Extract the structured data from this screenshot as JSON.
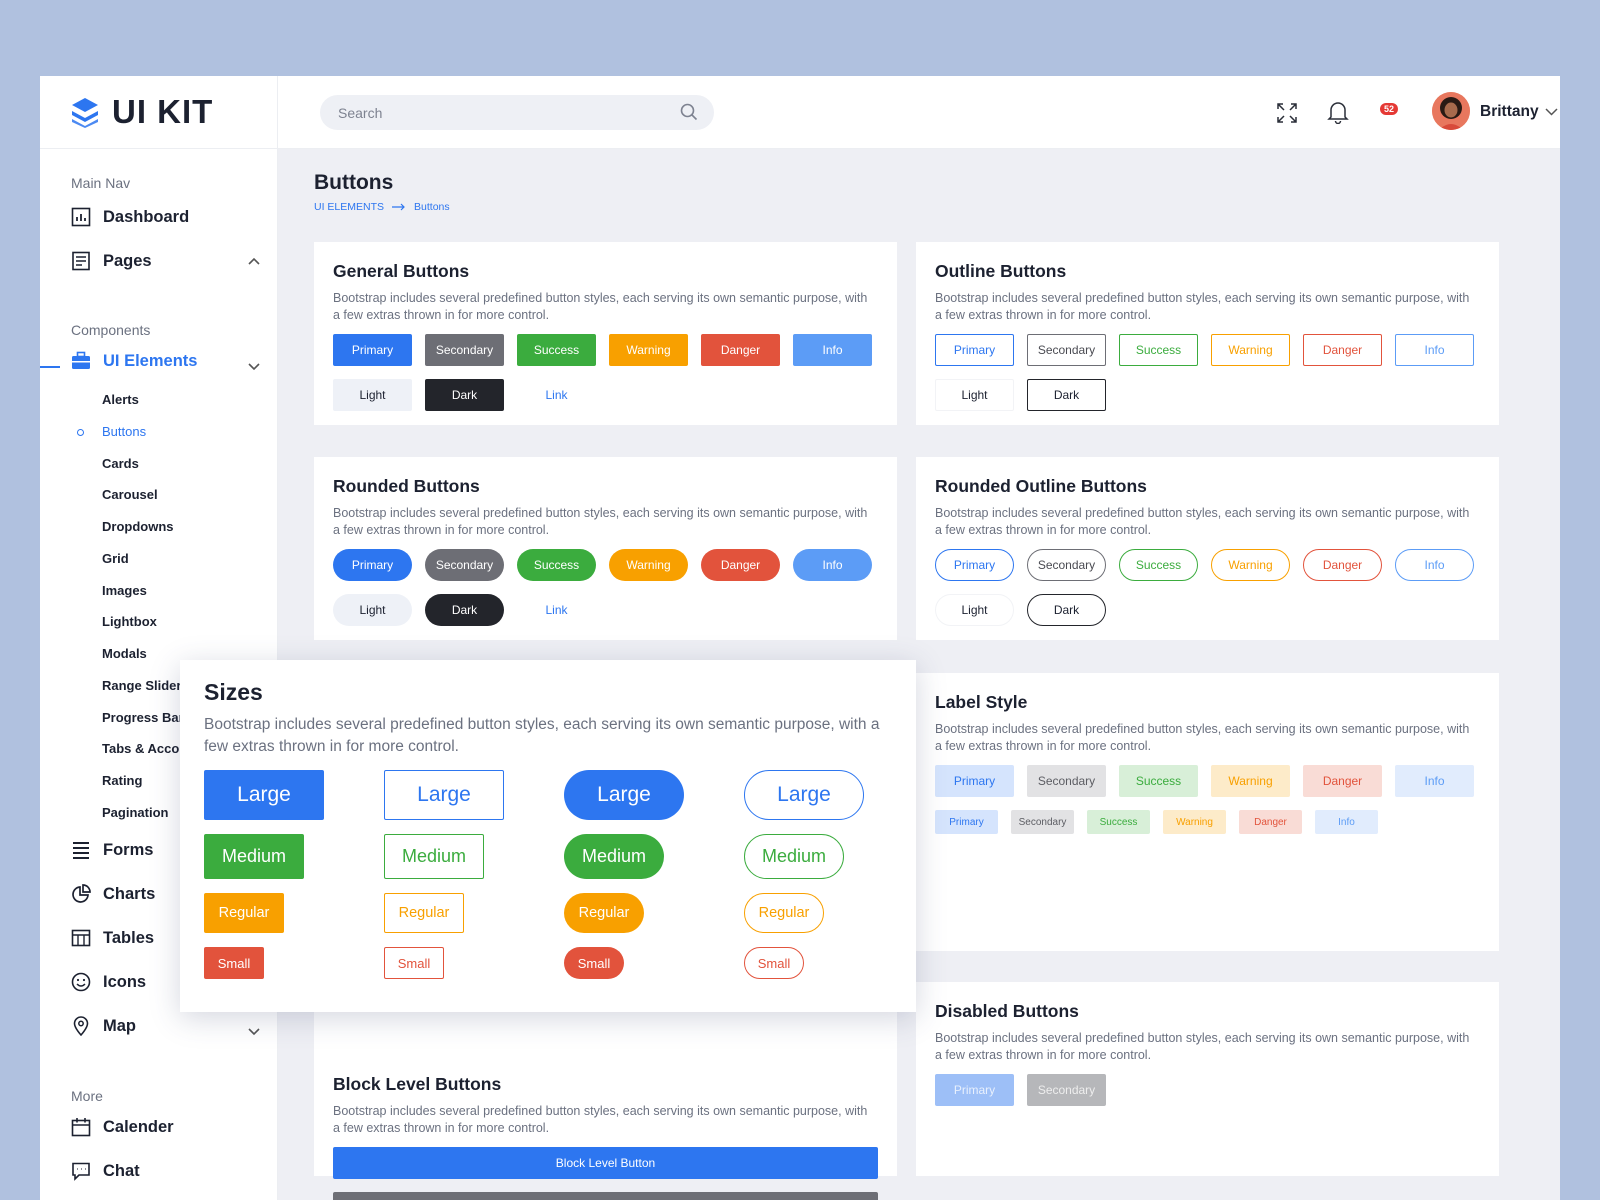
{
  "app": {
    "logo_text": "UI KIT"
  },
  "search": {
    "placeholder": "Search"
  },
  "notifications": {
    "count": "52"
  },
  "user": {
    "name": "Brittany"
  },
  "sidebar": {
    "main_nav_title": "Main Nav",
    "components_title": "Components",
    "more_title": "More",
    "dashboard": "Dashboard",
    "pages": "Pages",
    "ui_elements": "UI Elements",
    "subitems": [
      "Alerts",
      "Buttons",
      "Cards",
      "Carousel",
      "Dropdowns",
      "Grid",
      "Images",
      "Lightbox",
      "Modals",
      "Range Slider",
      "Progress Bar",
      "Tabs & Accordion",
      "Rating",
      "Pagination"
    ],
    "forms": "Forms",
    "charts": "Charts",
    "tables": "Tables",
    "icons": "Icons",
    "map": "Map",
    "calender": "Calender",
    "chat": "Chat"
  },
  "page": {
    "title": "Buttons",
    "breadcrumb_parent": "UI ELEMENTS",
    "breadcrumb_current": "Buttons"
  },
  "desc": "Bootstrap includes several predefined button styles, each serving its own semantic purpose, with a few extras thrown in for more control.",
  "labels": {
    "primary": "Primary",
    "secondary": "Secondary",
    "success": "Success",
    "warning": "Warning",
    "danger": "Danger",
    "info": "Info",
    "light": "Light",
    "dark": "Dark",
    "link": "Link"
  },
  "cards": {
    "general": "General Buttons",
    "outline": "Outline Buttons",
    "rounded": "Rounded Buttons",
    "rounded_outline": "Rounded Outline Buttons",
    "label": "Label Style",
    "block": "Block Level Buttons",
    "disabled": "Disabled Buttons",
    "sizes": "Sizes"
  },
  "block_label": "Block Level Button",
  "sizes": {
    "large": "Large",
    "medium": "Medium",
    "regular": "Regular",
    "small": "Small"
  },
  "colors": {
    "accent": "#2d76f0",
    "success": "#3bac3e",
    "warning": "#f8a000",
    "danger": "#e2533c",
    "secondary": "#6d6e75",
    "info": "#5c9cf6"
  }
}
